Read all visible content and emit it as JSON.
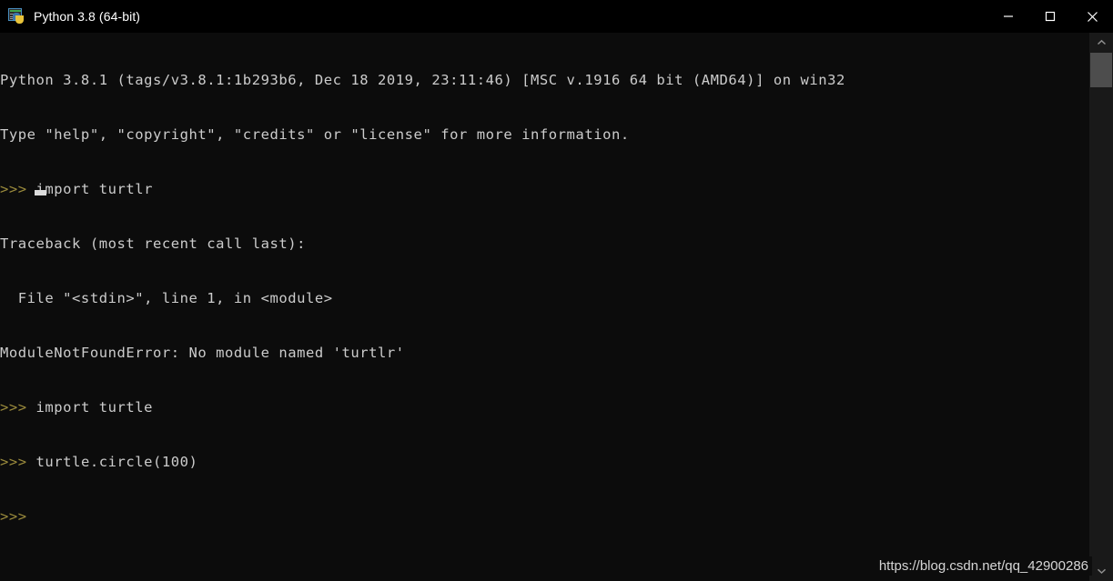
{
  "window": {
    "title": "Python 3.8 (64-bit)",
    "icon": "python-console-icon",
    "background_color": "#0c0c0c",
    "titlebar_color": "#000000",
    "text_color": "#cccccc",
    "prompt_color": "#9b8b3c"
  },
  "controls": {
    "minimize_label": "Minimize",
    "maximize_label": "Maximize",
    "close_label": "Close"
  },
  "terminal": {
    "lines": [
      {
        "id": "line-1",
        "prompt": "",
        "text": "Python 3.8.1 (tags/v3.8.1:1b293b6, Dec 18 2019, 23:11:46) [MSC v.1916 64 bit (AMD64)] on win32"
      },
      {
        "id": "line-2",
        "prompt": "",
        "text": "Type \"help\", \"copyright\", \"credits\" or \"license\" for more information."
      },
      {
        "id": "line-3",
        "prompt": ">>>",
        "text": " import turtlr"
      },
      {
        "id": "line-4",
        "prompt": "",
        "text": "Traceback (most recent call last):"
      },
      {
        "id": "line-5",
        "prompt": "",
        "text": "  File \"<stdin>\", line 1, in <module>"
      },
      {
        "id": "line-6",
        "prompt": "",
        "text": "ModuleNotFoundError: No module named 'turtlr'"
      },
      {
        "id": "line-7",
        "prompt": ">>>",
        "text": " import turtle"
      },
      {
        "id": "line-8",
        "prompt": ">>>",
        "text": " turtle.circle(100)"
      },
      {
        "id": "line-9",
        "prompt": ">>>",
        "text": ""
      }
    ],
    "cursor": "block-cursor"
  },
  "scrollbar": {
    "up_arrow": "chevron-up-icon",
    "down_arrow": "chevron-down-icon",
    "thumb_color": "#4d4d4d",
    "track_color": "#191919"
  },
  "watermark": {
    "text": "https://blog.csdn.net/qq_42900286"
  }
}
